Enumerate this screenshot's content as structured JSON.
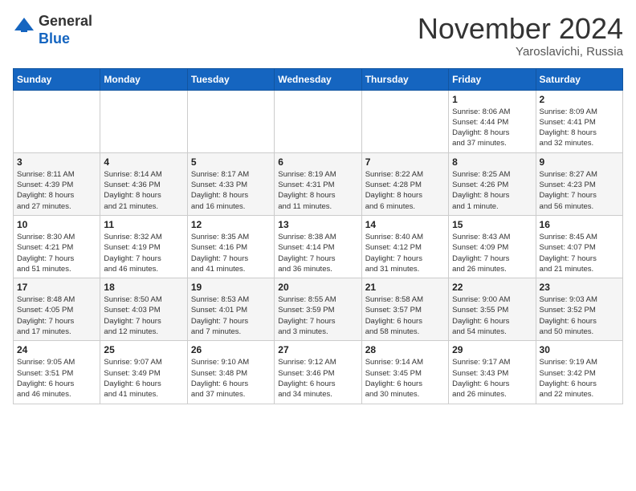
{
  "logo": {
    "general": "General",
    "blue": "Blue"
  },
  "header": {
    "month": "November 2024",
    "location": "Yaroslavichi, Russia"
  },
  "days_of_week": [
    "Sunday",
    "Monday",
    "Tuesday",
    "Wednesday",
    "Thursday",
    "Friday",
    "Saturday"
  ],
  "weeks": [
    [
      {
        "day": "",
        "info": ""
      },
      {
        "day": "",
        "info": ""
      },
      {
        "day": "",
        "info": ""
      },
      {
        "day": "",
        "info": ""
      },
      {
        "day": "",
        "info": ""
      },
      {
        "day": "1",
        "info": "Sunrise: 8:06 AM\nSunset: 4:44 PM\nDaylight: 8 hours\nand 37 minutes."
      },
      {
        "day": "2",
        "info": "Sunrise: 8:09 AM\nSunset: 4:41 PM\nDaylight: 8 hours\nand 32 minutes."
      }
    ],
    [
      {
        "day": "3",
        "info": "Sunrise: 8:11 AM\nSunset: 4:39 PM\nDaylight: 8 hours\nand 27 minutes."
      },
      {
        "day": "4",
        "info": "Sunrise: 8:14 AM\nSunset: 4:36 PM\nDaylight: 8 hours\nand 21 minutes."
      },
      {
        "day": "5",
        "info": "Sunrise: 8:17 AM\nSunset: 4:33 PM\nDaylight: 8 hours\nand 16 minutes."
      },
      {
        "day": "6",
        "info": "Sunrise: 8:19 AM\nSunset: 4:31 PM\nDaylight: 8 hours\nand 11 minutes."
      },
      {
        "day": "7",
        "info": "Sunrise: 8:22 AM\nSunset: 4:28 PM\nDaylight: 8 hours\nand 6 minutes."
      },
      {
        "day": "8",
        "info": "Sunrise: 8:25 AM\nSunset: 4:26 PM\nDaylight: 8 hours\nand 1 minute."
      },
      {
        "day": "9",
        "info": "Sunrise: 8:27 AM\nSunset: 4:23 PM\nDaylight: 7 hours\nand 56 minutes."
      }
    ],
    [
      {
        "day": "10",
        "info": "Sunrise: 8:30 AM\nSunset: 4:21 PM\nDaylight: 7 hours\nand 51 minutes."
      },
      {
        "day": "11",
        "info": "Sunrise: 8:32 AM\nSunset: 4:19 PM\nDaylight: 7 hours\nand 46 minutes."
      },
      {
        "day": "12",
        "info": "Sunrise: 8:35 AM\nSunset: 4:16 PM\nDaylight: 7 hours\nand 41 minutes."
      },
      {
        "day": "13",
        "info": "Sunrise: 8:38 AM\nSunset: 4:14 PM\nDaylight: 7 hours\nand 36 minutes."
      },
      {
        "day": "14",
        "info": "Sunrise: 8:40 AM\nSunset: 4:12 PM\nDaylight: 7 hours\nand 31 minutes."
      },
      {
        "day": "15",
        "info": "Sunrise: 8:43 AM\nSunset: 4:09 PM\nDaylight: 7 hours\nand 26 minutes."
      },
      {
        "day": "16",
        "info": "Sunrise: 8:45 AM\nSunset: 4:07 PM\nDaylight: 7 hours\nand 21 minutes."
      }
    ],
    [
      {
        "day": "17",
        "info": "Sunrise: 8:48 AM\nSunset: 4:05 PM\nDaylight: 7 hours\nand 17 minutes."
      },
      {
        "day": "18",
        "info": "Sunrise: 8:50 AM\nSunset: 4:03 PM\nDaylight: 7 hours\nand 12 minutes."
      },
      {
        "day": "19",
        "info": "Sunrise: 8:53 AM\nSunset: 4:01 PM\nDaylight: 7 hours\nand 7 minutes."
      },
      {
        "day": "20",
        "info": "Sunrise: 8:55 AM\nSunset: 3:59 PM\nDaylight: 7 hours\nand 3 minutes."
      },
      {
        "day": "21",
        "info": "Sunrise: 8:58 AM\nSunset: 3:57 PM\nDaylight: 6 hours\nand 58 minutes."
      },
      {
        "day": "22",
        "info": "Sunrise: 9:00 AM\nSunset: 3:55 PM\nDaylight: 6 hours\nand 54 minutes."
      },
      {
        "day": "23",
        "info": "Sunrise: 9:03 AM\nSunset: 3:52 PM\nDaylight: 6 hours\nand 50 minutes."
      }
    ],
    [
      {
        "day": "24",
        "info": "Sunrise: 9:05 AM\nSunset: 3:51 PM\nDaylight: 6 hours\nand 46 minutes."
      },
      {
        "day": "25",
        "info": "Sunrise: 9:07 AM\nSunset: 3:49 PM\nDaylight: 6 hours\nand 41 minutes."
      },
      {
        "day": "26",
        "info": "Sunrise: 9:10 AM\nSunset: 3:48 PM\nDaylight: 6 hours\nand 37 minutes."
      },
      {
        "day": "27",
        "info": "Sunrise: 9:12 AM\nSunset: 3:46 PM\nDaylight: 6 hours\nand 34 minutes."
      },
      {
        "day": "28",
        "info": "Sunrise: 9:14 AM\nSunset: 3:45 PM\nDaylight: 6 hours\nand 30 minutes."
      },
      {
        "day": "29",
        "info": "Sunrise: 9:17 AM\nSunset: 3:43 PM\nDaylight: 6 hours\nand 26 minutes."
      },
      {
        "day": "30",
        "info": "Sunrise: 9:19 AM\nSunset: 3:42 PM\nDaylight: 6 hours\nand 22 minutes."
      }
    ]
  ]
}
